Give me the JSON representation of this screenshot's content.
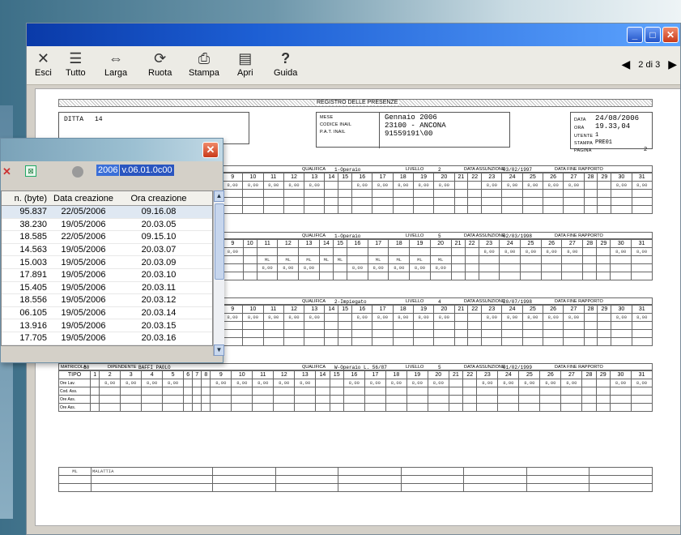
{
  "toolbar": {
    "items": [
      {
        "label": "Esci",
        "icon": "close-x-icon"
      },
      {
        "label": "Tutto",
        "icon": "all-pages-icon"
      },
      {
        "label": "Larga",
        "icon": "fit-width-icon"
      },
      {
        "label": "Ruota",
        "icon": "rotate-icon"
      },
      {
        "label": "Stampa",
        "icon": "printer-icon"
      },
      {
        "label": "Apri",
        "icon": "open-file-icon"
      },
      {
        "label": "Guida",
        "icon": "help-icon"
      }
    ],
    "pager": "2 di 3"
  },
  "report": {
    "title": "REGISTRO DELLE PRESENZE",
    "header_left_label": "DITTA",
    "header_left_value": "14",
    "mese_label": "MESE",
    "mese_value": "Gennaio  2006",
    "inail_label": "CODICE INAIL",
    "inail_value": "23100 - ANCONA",
    "pat_label": "P.A.T. INAIL",
    "pat_value": "91559191\\00",
    "data_label": "DATA",
    "data_value": "24/08/2006",
    "ora_label": "ORA",
    "ora_value": "19.33,04",
    "utente_label": "UTENTE",
    "utente_value": "1",
    "stampa_label": "STAMPA",
    "stampa_value": "PRE01",
    "pagina_label": "PAGINA",
    "pagina_value": "2",
    "sections": [
      {
        "qualifica": "1-Operaio",
        "livello": "2",
        "assunzione": "03/02/1997",
        "days_label": "9 10 11 12 13 14 15 16 17 18 19 20 21 22 23 24 25 26 27 28 29 30 31"
      },
      {
        "qualifica": "1-Operaio",
        "livello": "5",
        "assunzione": "02/03/1998"
      },
      {
        "qualifica": "2-Impiegato",
        "livello": "4",
        "assunzione": "20/07/1998"
      },
      {
        "matricola": "10",
        "dipendente": "BAFFI PAOLO",
        "qualifica": "W-Operaio L. 56/87",
        "livello": "5",
        "assunzione": "01/02/1999"
      }
    ],
    "labels": {
      "qualifica": "QUALIFICA",
      "livello": "LIVELLO",
      "assunzione": "DATA ASSUNZIONE",
      "fine": "DATA FINE RAPPORTO",
      "matricola": "MATRICOLA",
      "dipendente": "DIPENDENTE",
      "tipo": "TIPO",
      "ore_lav": "Ore Lav.",
      "cod_ass": "Cod. Ass.",
      "ore_ass": "Ore Ass."
    },
    "hours": "8,00",
    "ml": "ML",
    "legend_code": "ML",
    "legend_text": "MALATTIA"
  },
  "dialog": {
    "version_year": "2006",
    "version_text": "v.06.01.0c00",
    "columns": [
      "n. (byte)",
      "Data creazione",
      "Ora creazione"
    ],
    "rows": [
      [
        "95.837",
        "22/05/2006",
        "09.16.08"
      ],
      [
        "38.230",
        "19/05/2006",
        "20.03.05"
      ],
      [
        "18.585",
        "22/05/2006",
        "09.15.10"
      ],
      [
        "14.563",
        "19/05/2006",
        "20.03.07"
      ],
      [
        "15.003",
        "19/05/2006",
        "20.03.09"
      ],
      [
        "17.891",
        "19/05/2006",
        "20.03.10"
      ],
      [
        "15.405",
        "19/05/2006",
        "20.03.11"
      ],
      [
        "18.556",
        "19/05/2006",
        "20.03.12"
      ],
      [
        "06.105",
        "19/05/2006",
        "20.03.14"
      ],
      [
        "13.916",
        "19/05/2006",
        "20.03.15"
      ],
      [
        "17.705",
        "19/05/2006",
        "20.03.16"
      ]
    ]
  }
}
